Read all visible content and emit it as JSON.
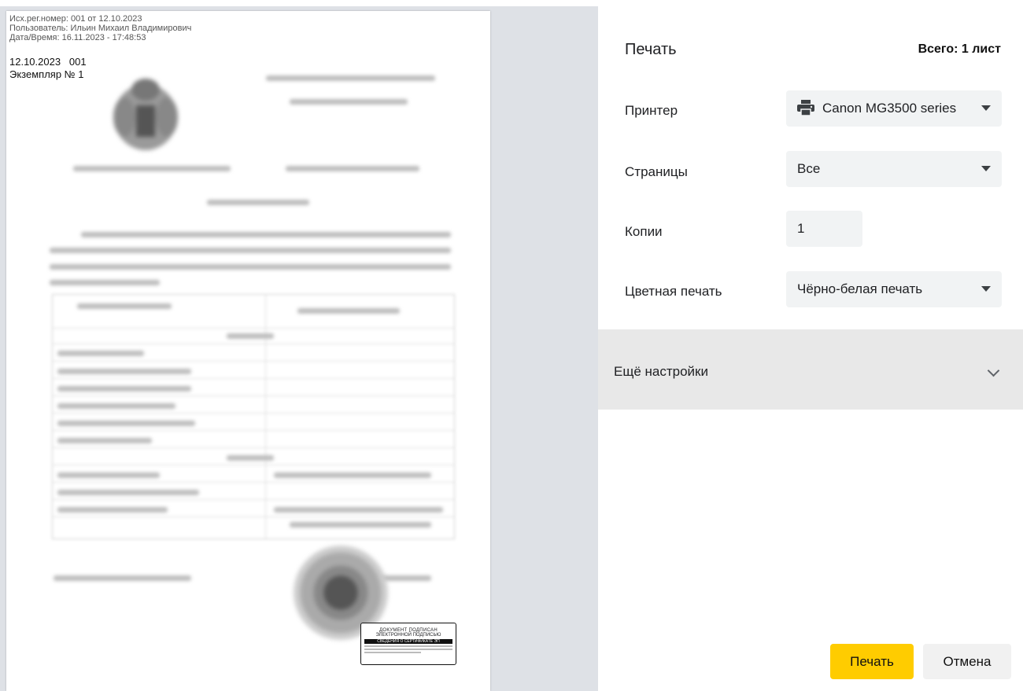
{
  "preview": {
    "meta_lines": [
      "Исх.рег.номер: 001 от 12.10.2023",
      "Пользователь: Ильин Михаил Владимирович",
      "Дата/Время: 16.11.2023 - 17:48:53"
    ],
    "doc_date_number": "12.10.2023   001",
    "copy_label": "Экземпляр № 1",
    "stamp": {
      "line1": "ДОКУМЕНТ ПОДПИСАН",
      "line2": "ЭЛЕКТРОННОЙ ПОДПИСЬЮ",
      "bar_text": "СВЕДЕНИЯ О СЕРТИФИКАТЕ ЭП"
    }
  },
  "panel": {
    "title": "Печать",
    "total": "Всего: 1 лист",
    "printer": {
      "label": "Принтер",
      "value": "Canon MG3500 series",
      "icon": "printer-icon"
    },
    "pages": {
      "label": "Страницы",
      "value": "Все"
    },
    "copies": {
      "label": "Копии",
      "value": "1"
    },
    "color": {
      "label": "Цветная печать",
      "value": "Чёрно-белая печать"
    },
    "more_settings": "Ещё настройки",
    "print_button": "Печать",
    "cancel_button": "Отмена"
  },
  "colors": {
    "accent": "#ffcc00",
    "preview_bg": "#dee1e6",
    "field_bg": "#f1f3f4"
  }
}
